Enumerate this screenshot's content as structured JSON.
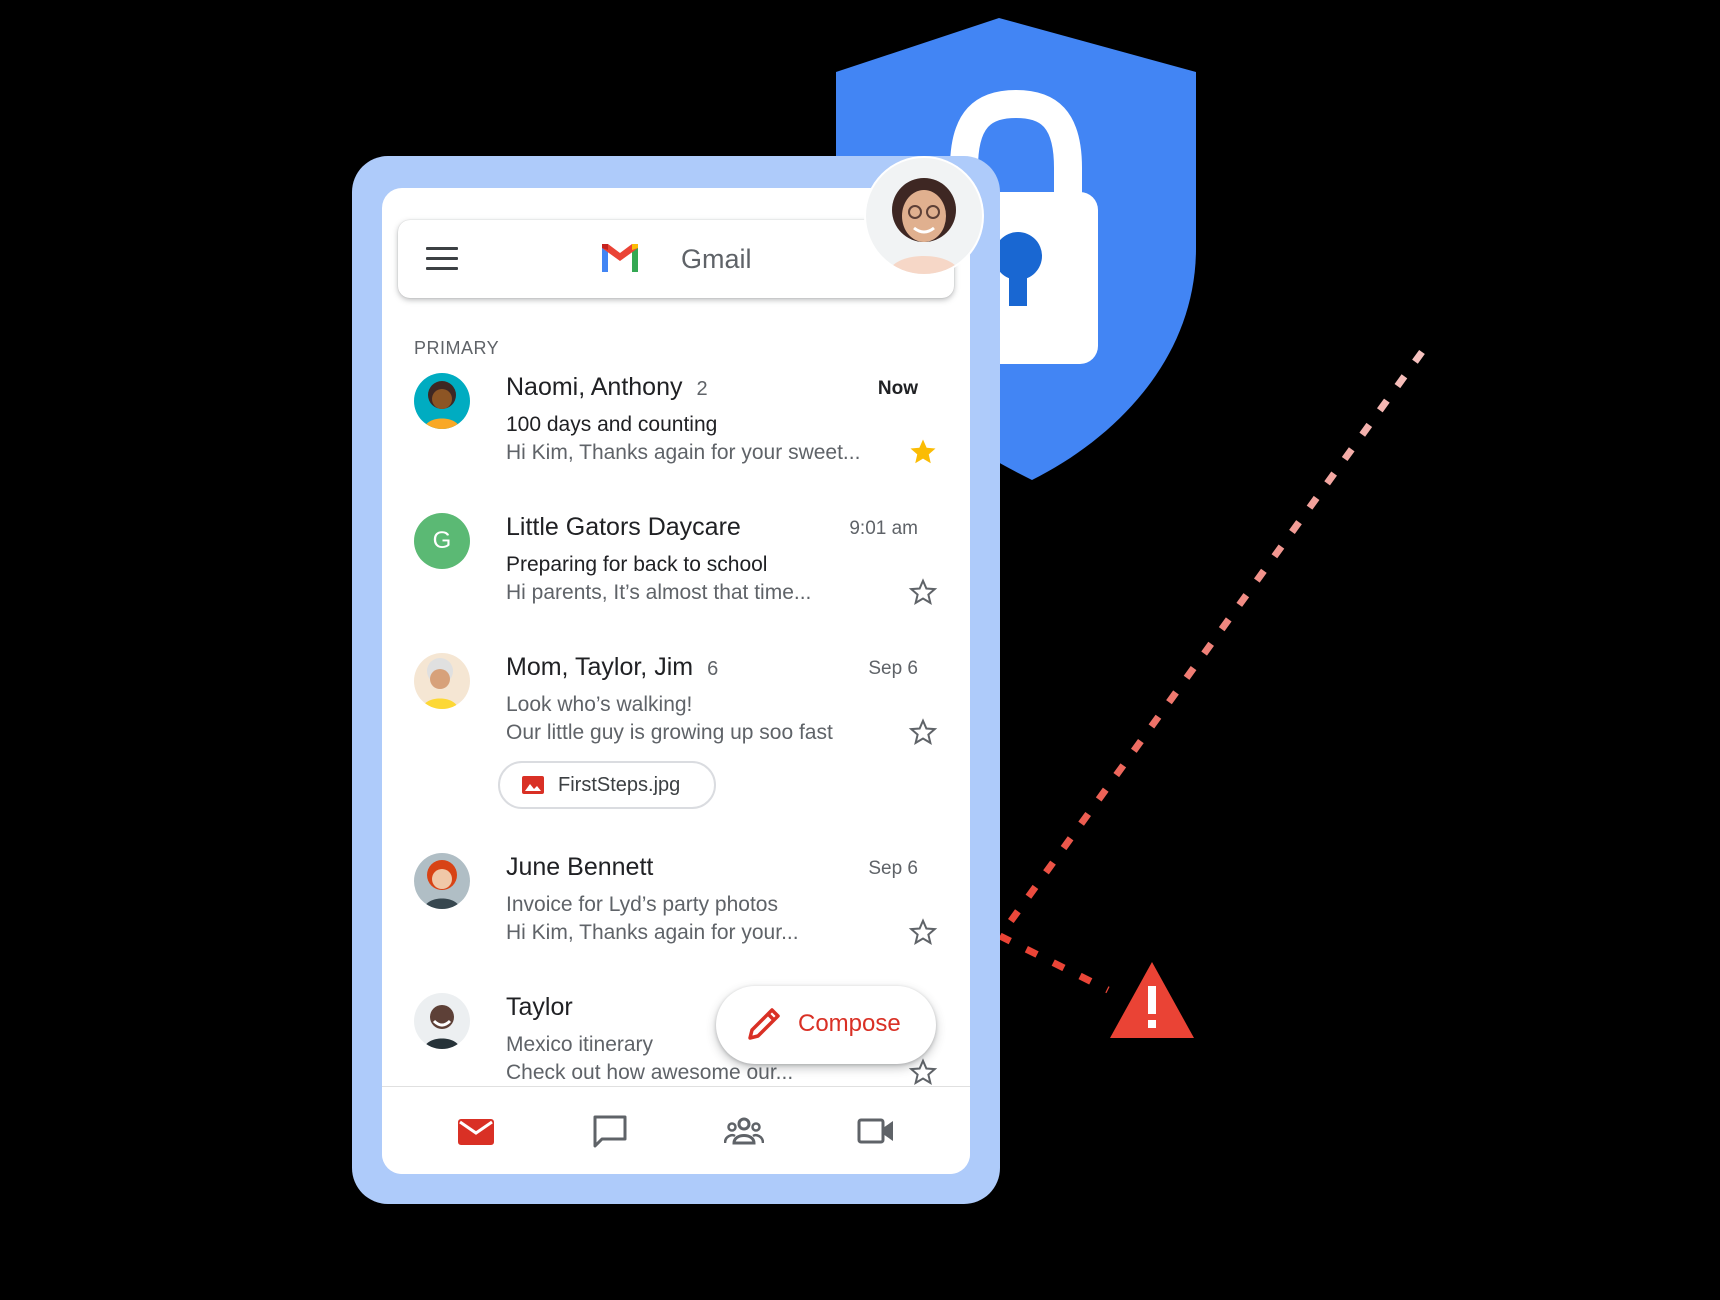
{
  "header": {
    "app_name": "Gmail",
    "menu_icon": "menu-icon",
    "logo": "gmail-logo"
  },
  "inbox": {
    "section_label": "PRIMARY",
    "emails": [
      {
        "sender": "Naomi, Anthony",
        "count": "2",
        "time": "Now",
        "subject": "100 days and counting",
        "snippet": "Hi Kim, Thanks again for your sweet...",
        "starred": true,
        "unread": true
      },
      {
        "sender": "Little Gators Daycare",
        "count": "",
        "time": "9:01 am",
        "subject": "Preparing for back to school",
        "snippet": "Hi parents, It’s almost that time...",
        "starred": false,
        "unread": true,
        "avatar_letter": "G"
      },
      {
        "sender": "Mom, Taylor, Jim",
        "count": "6",
        "time": "Sep 6",
        "subject": "Look who’s walking!",
        "snippet": "Our little guy is growing up soo fast",
        "starred": false,
        "unread": false,
        "attachment": "FirstSteps.jpg"
      },
      {
        "sender": "June Bennett",
        "count": "",
        "time": "Sep 6",
        "subject": "Invoice for Lyd’s party photos",
        "snippet": "Hi Kim, Thanks again for your...",
        "starred": false,
        "unread": false
      },
      {
        "sender": "Taylor",
        "count": "",
        "time": "",
        "subject": "Mexico itinerary",
        "snippet": "Check out how awesome our...",
        "starred": false,
        "unread": false
      }
    ]
  },
  "compose": {
    "label": "Compose"
  },
  "bottom_nav": [
    "mail-icon",
    "chat-icon",
    "spaces-icon",
    "meet-icon"
  ],
  "colors": {
    "shield": "#4285f4",
    "frame": "#aecbfa",
    "accent_red": "#d93025",
    "star": "#fbbc04"
  }
}
